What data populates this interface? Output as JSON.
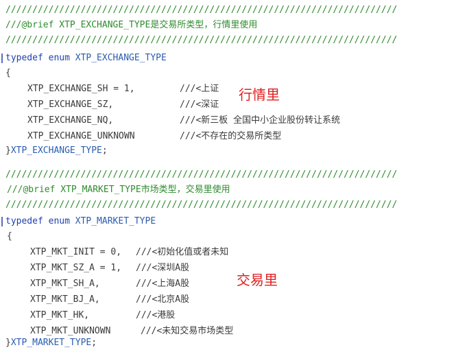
{
  "block1": {
    "sep1": "/////////////////////////////////////////////////////////////////////////",
    "brief": "///@brief XTP_EXCHANGE_TYPE是交易所类型，行情里使用",
    "sep2": "/////////////////////////////////////////////////////////////////////////",
    "typedef_kw": "typedef enum ",
    "typedef_name": "XTP_EXCHANGE_TYPE",
    "open_brace": "{",
    "members": [
      {
        "code": "XTP_EXCHANGE_SH = 1,",
        "comment": "///<上证"
      },
      {
        "code": "XTP_EXCHANGE_SZ,",
        "comment": "///<深证"
      },
      {
        "code": "XTP_EXCHANGE_NQ,",
        "comment": "///<新三板 全国中小企业股份转让系统"
      },
      {
        "code": "XTP_EXCHANGE_UNKNOWN",
        "comment": "///<不存在的交易所类型"
      }
    ],
    "close_brace": "}",
    "close_name": "XTP_EXCHANGE_TYPE",
    "close_semicolon": ";",
    "annotation": "行情里"
  },
  "block2": {
    "sep1": "/////////////////////////////////////////////////////////////////////////",
    "brief": "///@brief XTP_MARKET_TYPE市场类型，交易里使用",
    "sep2": "/////////////////////////////////////////////////////////////////////////",
    "typedef_kw": "typedef enum ",
    "typedef_name": "XTP_MARKET_TYPE",
    "open_brace": "{",
    "members": [
      {
        "code": "XTP_MKT_INIT = 0,",
        "comment": "///<初始化值或者未知"
      },
      {
        "code": "XTP_MKT_SZ_A = 1,",
        "comment": "///<深圳A股"
      },
      {
        "code": "XTP_MKT_SH_A,",
        "comment": "///<上海A股"
      },
      {
        "code": "XTP_MKT_BJ_A,",
        "comment": "///<北京A股"
      },
      {
        "code": "XTP_MKT_HK,",
        "comment": "///<港股"
      },
      {
        "code": "XTP_MKT_UNKNOWN",
        "comment": "///<未知交易市场类型"
      }
    ],
    "close_brace": "}",
    "close_name": "XTP_MARKET_TYPE",
    "close_semicolon": ";",
    "annotation": "交易里"
  },
  "colors": {
    "comment": "#2e8b2e",
    "keyword": "#1e3fb0",
    "identifier": "#2a5cb0",
    "annotation": "#e02020"
  }
}
